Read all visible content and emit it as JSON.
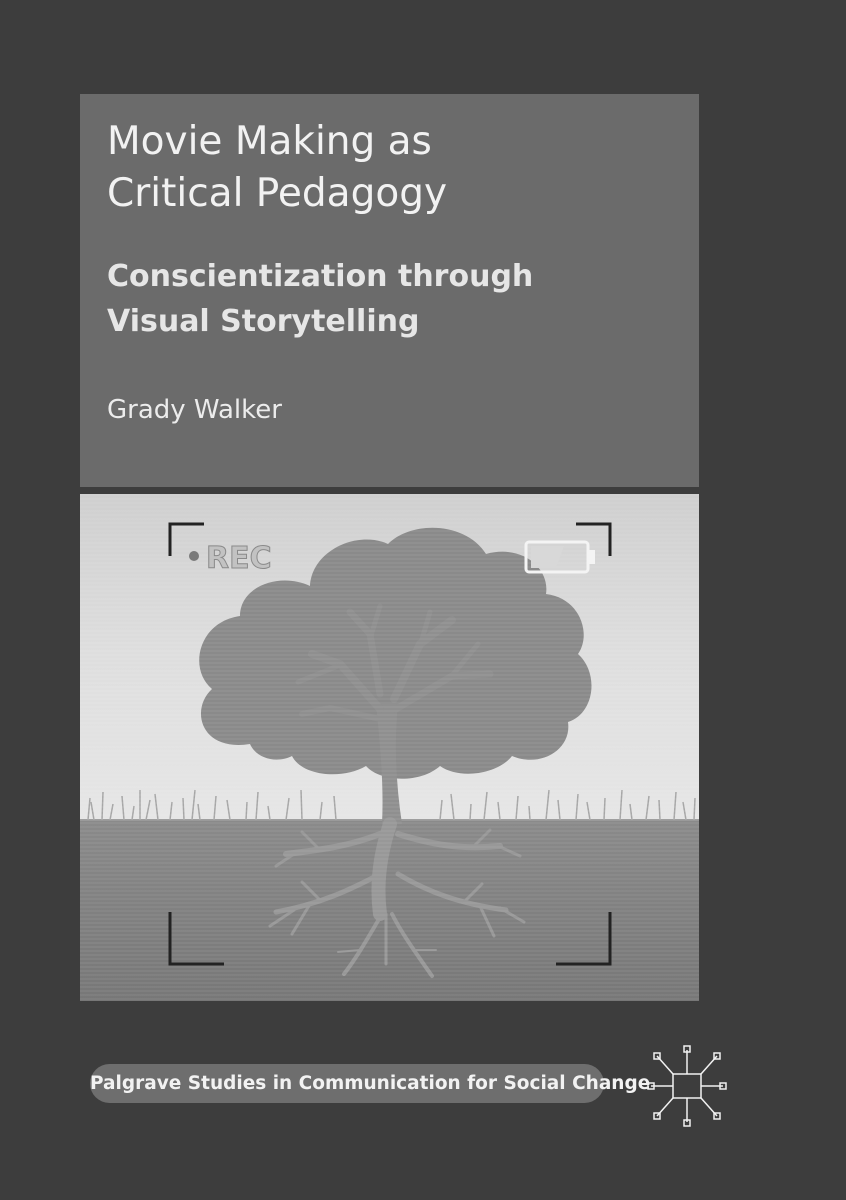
{
  "book": {
    "title_lines": [
      "Movie Making as",
      "Critical Pedagogy"
    ],
    "subtitle_lines": [
      "Conscientization through",
      "Visual Storytelling"
    ],
    "author": "Grady Walker",
    "series": "Palgrave Studies in Communication for Social Change"
  },
  "viewfinder": {
    "rec_label": "REC"
  },
  "publisher_logo": {
    "icon": "palgrave-logo-icon"
  },
  "colors": {
    "background": "#3d3d3d",
    "title_panel": "#6b6b6b",
    "text": "#f2f2f2",
    "series_badge": "#6e6e6e"
  }
}
